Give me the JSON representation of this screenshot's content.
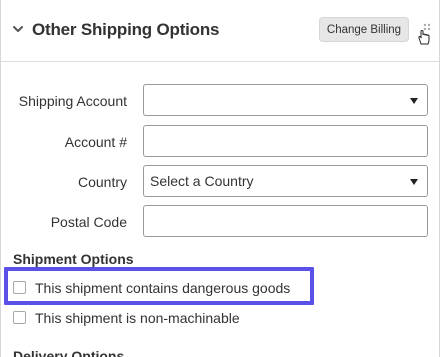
{
  "header": {
    "title": "Other Shipping Options",
    "change_billing_label": "Change Billing"
  },
  "form": {
    "shipping_account": {
      "label": "Shipping Account",
      "value": ""
    },
    "account_number": {
      "label": "Account #",
      "value": ""
    },
    "country": {
      "label": "Country",
      "value": "Select a Country"
    },
    "postal_code": {
      "label": "Postal Code",
      "value": ""
    }
  },
  "shipment_options": {
    "title": "Shipment Options",
    "items": [
      {
        "label": "This shipment contains dangerous goods",
        "checked": false,
        "highlighted": true
      },
      {
        "label": "This shipment is non-machinable",
        "checked": false,
        "highlighted": false
      }
    ]
  },
  "next_section_partial": "Delivery Options",
  "colors": {
    "highlight": "#5b50e8",
    "button_bg": "#e6e6e6",
    "border": "#9a9a9a"
  },
  "icons": [
    "chevron-down-icon",
    "drag-handle-icon",
    "dropdown-caret-icon"
  ]
}
